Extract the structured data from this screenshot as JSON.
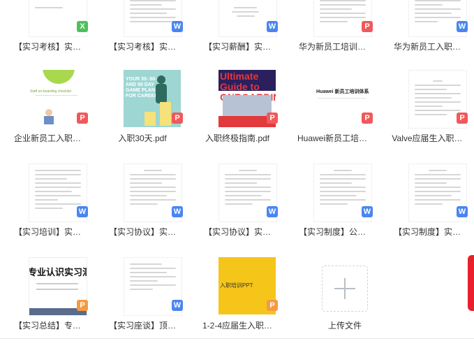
{
  "files": [
    {
      "label": "【实习考核】实…",
      "type": "xls",
      "badge": "X"
    },
    {
      "label": "【实习考核】实…",
      "type": "doc",
      "badge": "W"
    },
    {
      "label": "【实习薪酬】实…",
      "type": "doc",
      "badge": "W"
    },
    {
      "label": "华为新员工培训…",
      "type": "pdf",
      "badge": "P"
    },
    {
      "label": "华为新员工入职…",
      "type": "doc",
      "badge": "W"
    },
    {
      "label": "企业新员工入职…",
      "type": "pdf",
      "badge": "P",
      "thumb_text": "Staff on-boarding checklist"
    },
    {
      "label": "入职30天.pdf",
      "type": "pdf",
      "badge": "P",
      "thumb_text": "YOUR 30- 60- AND 90 DAY GAME PLAN FOR CAREER"
    },
    {
      "label": "入职终极指南.pdf",
      "type": "pdf",
      "badge": "P",
      "thumb_text": "Ultimate Guide to ONBOARDING"
    },
    {
      "label": "Huawei新员工培…",
      "type": "pdf",
      "badge": "P",
      "thumb_text": "Huawei 新员工培训体系"
    },
    {
      "label": "Valve应届生入职…",
      "type": "pdf",
      "badge": "P"
    },
    {
      "label": "【实习培训】实…",
      "type": "doc",
      "badge": "W"
    },
    {
      "label": "【实习协议】实…",
      "type": "doc",
      "badge": "W"
    },
    {
      "label": "【实习协议】实…",
      "type": "doc",
      "badge": "W"
    },
    {
      "label": "【实习制度】公…",
      "type": "doc",
      "badge": "W"
    },
    {
      "label": "【实习制度】实…",
      "type": "doc",
      "badge": "W"
    },
    {
      "label": "【实习总结】专…",
      "type": "ppt",
      "badge": "P",
      "thumb_text": "专业认识实习汇"
    },
    {
      "label": "【实习座谈】顶…",
      "type": "doc",
      "badge": "W"
    },
    {
      "label": "1-2-4应届生入职…",
      "type": "ppt",
      "badge": "P",
      "thumb_text": "入职培训PPT"
    }
  ],
  "upload": {
    "label": "上传文件"
  },
  "colors": {
    "word": "#4a86f0",
    "excel": "#4cc15a",
    "pdf": "#f0595b",
    "ppt": "#f59a42",
    "side": "#e9202c"
  }
}
